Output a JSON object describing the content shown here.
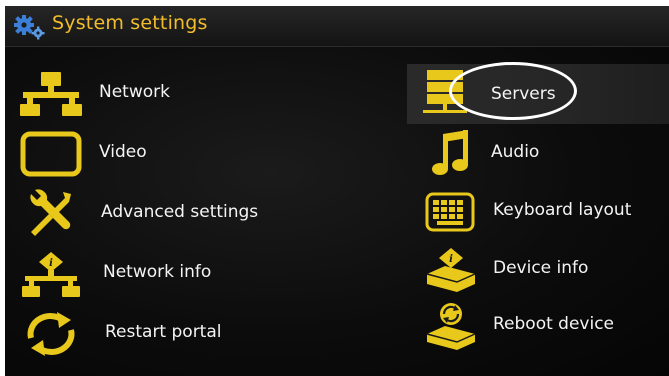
{
  "header": {
    "title": "System settings",
    "icon": "gears-icon"
  },
  "menu": {
    "left": [
      {
        "label": "Network",
        "icon": "network-icon"
      },
      {
        "label": "Video",
        "icon": "monitor-icon"
      },
      {
        "label": "Advanced settings",
        "icon": "tools-icon"
      },
      {
        "label": "Network info",
        "icon": "network-info-icon"
      },
      {
        "label": "Restart portal",
        "icon": "refresh-icon"
      }
    ],
    "right": [
      {
        "label": "Servers",
        "icon": "server-icon",
        "selected": true
      },
      {
        "label": "Audio",
        "icon": "music-note-icon"
      },
      {
        "label": "Keyboard layout",
        "icon": "keyboard-icon"
      },
      {
        "label": "Device info",
        "icon": "device-info-icon"
      },
      {
        "label": "Reboot device",
        "icon": "reboot-device-icon"
      }
    ]
  },
  "colors": {
    "accent": "#f2bd2a",
    "icon": "#e8c81a",
    "text": "#f4f4f4",
    "annotation": "#ffffff"
  }
}
